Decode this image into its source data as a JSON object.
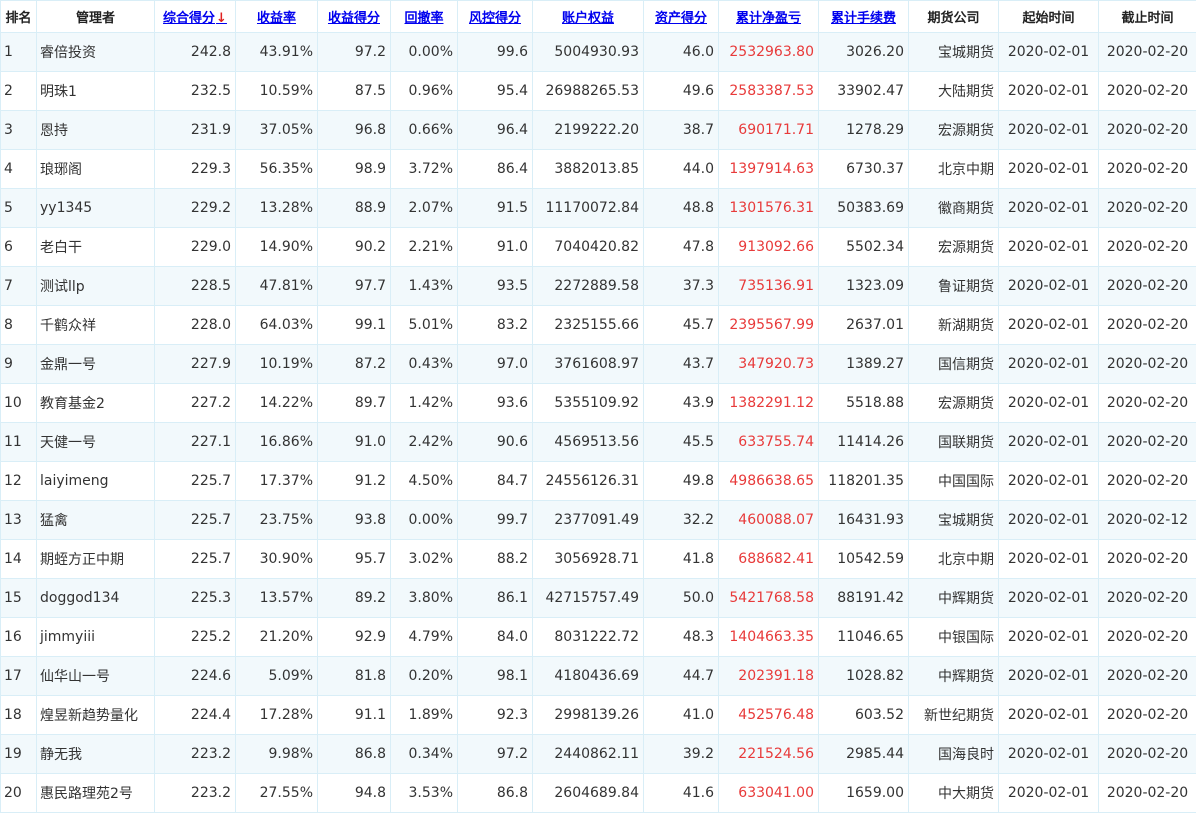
{
  "columns": [
    {
      "key": "rank",
      "label": "排名",
      "sortable": false
    },
    {
      "key": "manager",
      "label": "管理者",
      "sortable": false
    },
    {
      "key": "composite_score",
      "label": "综合得分",
      "sortable": true,
      "sort_indicator": "↓"
    },
    {
      "key": "return_rate",
      "label": "收益率",
      "sortable": true
    },
    {
      "key": "return_score",
      "label": "收益得分",
      "sortable": true
    },
    {
      "key": "drawdown",
      "label": "回撤率",
      "sortable": true
    },
    {
      "key": "risk_score",
      "label": "风控得分",
      "sortable": true
    },
    {
      "key": "equity",
      "label": "账户权益",
      "sortable": true
    },
    {
      "key": "asset_score",
      "label": "资产得分",
      "sortable": true
    },
    {
      "key": "net_pnl",
      "label": "累计净盈亏",
      "sortable": true
    },
    {
      "key": "fees",
      "label": "累计手续费",
      "sortable": true
    },
    {
      "key": "broker",
      "label": "期货公司",
      "sortable": false
    },
    {
      "key": "start",
      "label": "起始时间",
      "sortable": false
    },
    {
      "key": "end",
      "label": "截止时间",
      "sortable": false
    }
  ],
  "colors": {
    "link": "#0000ee",
    "pnl_red": "#e83a3a",
    "border": "#d9eef7",
    "row_alt": "#f2f9fc"
  },
  "rows": [
    [
      "1",
      "睿倍投资",
      "242.8",
      "43.91%",
      "97.2",
      "0.00%",
      "99.6",
      "5004930.93",
      "46.0",
      "2532963.80",
      "3026.20",
      "宝城期货",
      "2020-02-01",
      "2020-02-20"
    ],
    [
      "2",
      "明珠1",
      "232.5",
      "10.59%",
      "87.5",
      "0.96%",
      "95.4",
      "26988265.53",
      "49.6",
      "2583387.53",
      "33902.47",
      "大陆期货",
      "2020-02-01",
      "2020-02-20"
    ],
    [
      "3",
      "恩持",
      "231.9",
      "37.05%",
      "96.8",
      "0.66%",
      "96.4",
      "2199222.20",
      "38.7",
      "690171.71",
      "1278.29",
      "宏源期货",
      "2020-02-01",
      "2020-02-20"
    ],
    [
      "4",
      "琅琊阁",
      "229.3",
      "56.35%",
      "98.9",
      "3.72%",
      "86.4",
      "3882013.85",
      "44.0",
      "1397914.63",
      "6730.37",
      "北京中期",
      "2020-02-01",
      "2020-02-20"
    ],
    [
      "5",
      "yy1345",
      "229.2",
      "13.28%",
      "88.9",
      "2.07%",
      "91.5",
      "11170072.84",
      "48.8",
      "1301576.31",
      "50383.69",
      "徽商期货",
      "2020-02-01",
      "2020-02-20"
    ],
    [
      "6",
      "老白干",
      "229.0",
      "14.90%",
      "90.2",
      "2.21%",
      "91.0",
      "7040420.82",
      "47.8",
      "913092.66",
      "5502.34",
      "宏源期货",
      "2020-02-01",
      "2020-02-20"
    ],
    [
      "7",
      "测试llp",
      "228.5",
      "47.81%",
      "97.7",
      "1.43%",
      "93.5",
      "2272889.58",
      "37.3",
      "735136.91",
      "1323.09",
      "鲁证期货",
      "2020-02-01",
      "2020-02-20"
    ],
    [
      "8",
      "千鹤众祥",
      "228.0",
      "64.03%",
      "99.1",
      "5.01%",
      "83.2",
      "2325155.66",
      "45.7",
      "2395567.99",
      "2637.01",
      "新湖期货",
      "2020-02-01",
      "2020-02-20"
    ],
    [
      "9",
      "金鼎一号",
      "227.9",
      "10.19%",
      "87.2",
      "0.43%",
      "97.0",
      "3761608.97",
      "43.7",
      "347920.73",
      "1389.27",
      "国信期货",
      "2020-02-01",
      "2020-02-20"
    ],
    [
      "10",
      "教育基金2",
      "227.2",
      "14.22%",
      "89.7",
      "1.42%",
      "93.6",
      "5355109.92",
      "43.9",
      "1382291.12",
      "5518.88",
      "宏源期货",
      "2020-02-01",
      "2020-02-20"
    ],
    [
      "11",
      "天健一号",
      "227.1",
      "16.86%",
      "91.0",
      "2.42%",
      "90.6",
      "4569513.56",
      "45.5",
      "633755.74",
      "11414.26",
      "国联期货",
      "2020-02-01",
      "2020-02-20"
    ],
    [
      "12",
      "laiyimeng",
      "225.7",
      "17.37%",
      "91.2",
      "4.50%",
      "84.7",
      "24556126.31",
      "49.8",
      "4986638.65",
      "118201.35",
      "中国国际",
      "2020-02-01",
      "2020-02-20"
    ],
    [
      "13",
      "猛禽",
      "225.7",
      "23.75%",
      "93.8",
      "0.00%",
      "99.7",
      "2377091.49",
      "32.2",
      "460088.07",
      "16431.93",
      "宝城期货",
      "2020-02-01",
      "2020-02-12"
    ],
    [
      "14",
      "期蛭方正中期",
      "225.7",
      "30.90%",
      "95.7",
      "3.02%",
      "88.2",
      "3056928.71",
      "41.8",
      "688682.41",
      "10542.59",
      "北京中期",
      "2020-02-01",
      "2020-02-20"
    ],
    [
      "15",
      "doggod134",
      "225.3",
      "13.57%",
      "89.2",
      "3.80%",
      "86.1",
      "42715757.49",
      "50.0",
      "5421768.58",
      "88191.42",
      "中辉期货",
      "2020-02-01",
      "2020-02-20"
    ],
    [
      "16",
      "jimmyiii",
      "225.2",
      "21.20%",
      "92.9",
      "4.79%",
      "84.0",
      "8031222.72",
      "48.3",
      "1404663.35",
      "11046.65",
      "中银国际",
      "2020-02-01",
      "2020-02-20"
    ],
    [
      "17",
      "仙华山一号",
      "224.6",
      "5.09%",
      "81.8",
      "0.20%",
      "98.1",
      "4180436.69",
      "44.7",
      "202391.18",
      "1028.82",
      "中辉期货",
      "2020-02-01",
      "2020-02-20"
    ],
    [
      "18",
      "煌昱新趋势量化",
      "224.4",
      "17.28%",
      "91.1",
      "1.89%",
      "92.3",
      "2998139.26",
      "41.0",
      "452576.48",
      "603.52",
      "新世纪期货",
      "2020-02-01",
      "2020-02-20"
    ],
    [
      "19",
      "静无我",
      "223.2",
      "9.98%",
      "86.8",
      "0.34%",
      "97.2",
      "2440862.11",
      "39.2",
      "221524.56",
      "2985.44",
      "国海良时",
      "2020-02-01",
      "2020-02-20"
    ],
    [
      "20",
      "惠民路理苑2号",
      "223.2",
      "27.55%",
      "94.8",
      "3.53%",
      "86.8",
      "2604689.84",
      "41.6",
      "633041.00",
      "1659.00",
      "中大期货",
      "2020-02-01",
      "2020-02-20"
    ]
  ]
}
